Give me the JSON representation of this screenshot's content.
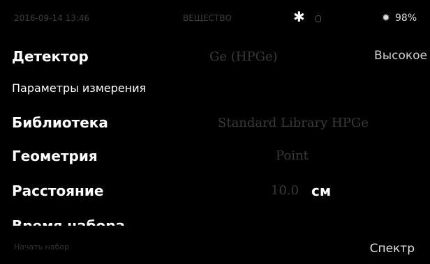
{
  "status_bar": {
    "left_text": "2016-09-14 13:46",
    "mid_text": "ВЕЩЕСТВО",
    "snow_icon": "snowflake-icon",
    "sensor_icon": "sensor-icon",
    "gear_icon": "gear-icon",
    "battery": "98%"
  },
  "detector": {
    "label": "Детектор",
    "value": "Высокое",
    "faint_value": "Ge (HPGe)"
  },
  "parameters": {
    "label": "Параметры измерения"
  },
  "library": {
    "label": "Библиотека",
    "faint_value": "Standard Library HPGe"
  },
  "geometry": {
    "label": "Геометрия",
    "faint_value": "Point"
  },
  "distance": {
    "label": "Расстояние",
    "faint_value": "10.0",
    "unit": "см"
  },
  "next_row": {
    "label": "Время набора"
  },
  "bottom": {
    "faint_text": "Начать набор",
    "spectrum_button": "Спектр"
  }
}
